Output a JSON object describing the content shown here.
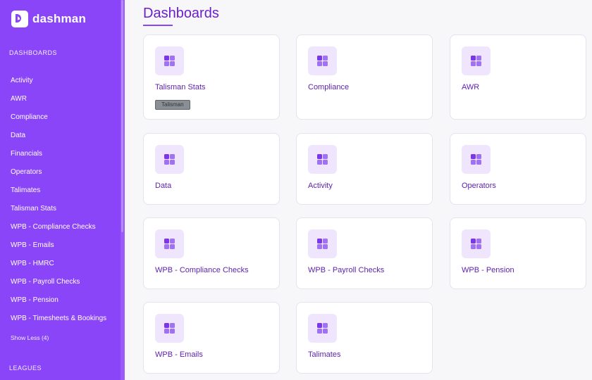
{
  "brand": {
    "name": "dashman"
  },
  "sidebar": {
    "sections": [
      "DASHBOARDS",
      "LEAGUES"
    ],
    "items": [
      {
        "label": "Activity"
      },
      {
        "label": "AWR"
      },
      {
        "label": "Compliance"
      },
      {
        "label": "Data"
      },
      {
        "label": "Financials"
      },
      {
        "label": "Operators"
      },
      {
        "label": "Talimates"
      },
      {
        "label": "Talisman Stats"
      },
      {
        "label": "WPB - Compliance Checks"
      },
      {
        "label": "WPB - Emails"
      },
      {
        "label": "WPB - HMRC"
      },
      {
        "label": "WPB - Payroll Checks"
      },
      {
        "label": "WPB - Pension"
      },
      {
        "label": "WPB - Timesheets & Bookings"
      }
    ],
    "show_less": "Show Less (4)"
  },
  "main": {
    "title": "Dashboards",
    "cards": [
      {
        "label": "Talisman Stats",
        "tag": "Talisman"
      },
      {
        "label": "Compliance"
      },
      {
        "label": "AWR"
      },
      {
        "label": "Data"
      },
      {
        "label": "Activity"
      },
      {
        "label": "Operators"
      },
      {
        "label": "WPB - Compliance Checks"
      },
      {
        "label": "WPB - Payroll Checks"
      },
      {
        "label": "WPB - Pension"
      },
      {
        "label": "WPB - Emails"
      },
      {
        "label": "Talimates"
      }
    ]
  },
  "colors": {
    "sidebar": "#8b45f8",
    "accent": "#6a1fc9",
    "icon_bg": "#efe6fe"
  },
  "icons": {
    "card": "dashboard-grid-icon",
    "logo": "dashman-logo-icon"
  }
}
